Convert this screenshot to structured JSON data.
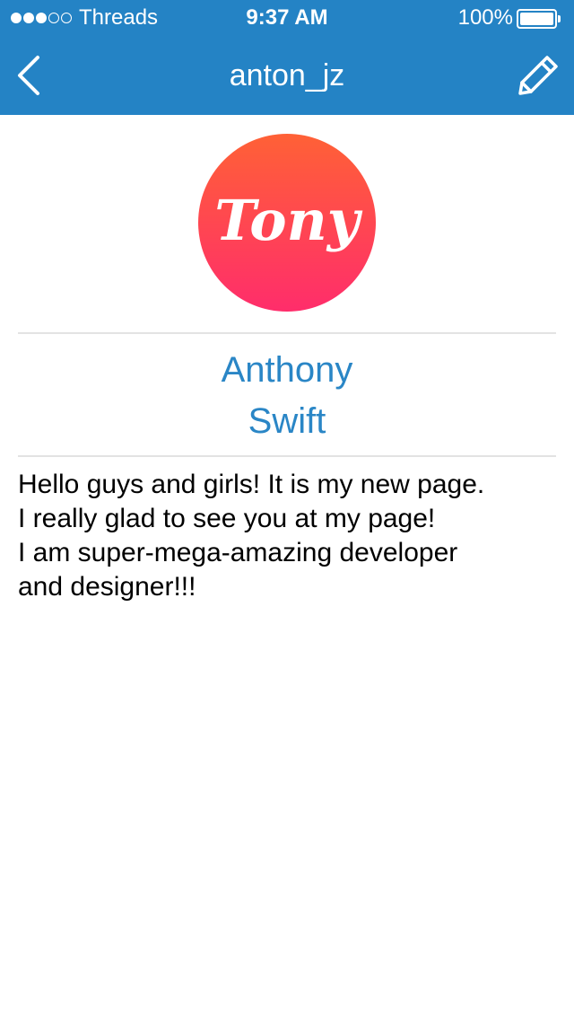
{
  "status_bar": {
    "carrier": "Threads",
    "time": "9:37 AM",
    "battery_percent": "100%",
    "signal_bars_filled": 3,
    "signal_bars_total": 5,
    "battery_level": 1.0
  },
  "nav": {
    "title": "anton_jz",
    "back_icon": "chevron-left-icon",
    "edit_icon": "pencil-icon"
  },
  "profile": {
    "avatar_text": "Tony",
    "first_name": "Anthony",
    "last_name": "Swift",
    "bio_lines": [
      "Hello guys and girls! It is my new page.",
      "I really glad to see you at my page!",
      "I am super-mega-amazing developer",
      "and designer!!!"
    ]
  },
  "colors": {
    "header_bg": "#2483c5",
    "name_text": "#2a86c6",
    "avatar_gradient_top": "#ff6136",
    "avatar_gradient_bottom": "#ff2d6b"
  }
}
